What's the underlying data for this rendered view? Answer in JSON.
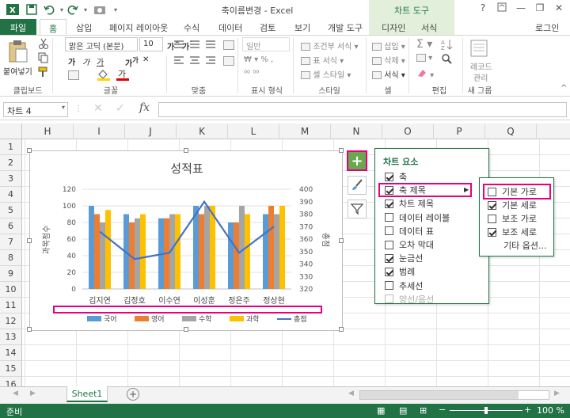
{
  "app": {
    "title": "축이름변경 - Excel",
    "context_tab": "차트 도구",
    "user": "로그인"
  },
  "tabs": [
    "파일",
    "홈",
    "삽입",
    "페이지 레이아웃",
    "수식",
    "데이터",
    "검토",
    "보기",
    "개발 도구",
    "디자인",
    "서식"
  ],
  "ribbon": {
    "paste": "붙여넣기",
    "font_name": "맑은 고딕 (본문)",
    "font_size": "10",
    "number_format": "일반",
    "cond_format": "조건부 서식",
    "table_format": "표 서식",
    "cell_style": "셀 스타일",
    "insert": "삽입",
    "delete": "삭제",
    "format": "서식",
    "record": "레코드",
    "manage": "관리",
    "groups": [
      "클립보드",
      "글꼴",
      "맞춤",
      "표시 형식",
      "스타일",
      "셀",
      "편집",
      "새 그룹"
    ]
  },
  "formula": {
    "name_box": "차트 4",
    "fx": "fx",
    "value": ""
  },
  "grid": {
    "columns": [
      "H",
      "I",
      "J",
      "K",
      "L",
      "M",
      "N",
      "O",
      "P",
      "Q"
    ],
    "rows": [
      "1",
      "2",
      "3",
      "4",
      "5",
      "6",
      "7",
      "8",
      "9",
      "10",
      "11",
      "12",
      "13",
      "14",
      "15",
      "16"
    ]
  },
  "sheet": {
    "tab": "Sheet1",
    "status": "준비",
    "zoom": "100 %"
  },
  "chart_data": {
    "type": "bar",
    "title": "성적표",
    "ylabel": "과목점수",
    "y2label": "총점",
    "categories": [
      "김지연",
      "김정호",
      "이수연",
      "이성훈",
      "정은주",
      "정상현"
    ],
    "ylim": [
      0,
      120
    ],
    "yticks": [
      "0",
      "20",
      "40",
      "60",
      "80",
      "100",
      "120"
    ],
    "y2lim": [
      320,
      400
    ],
    "y2ticks": [
      "320",
      "330",
      "340",
      "350",
      "360",
      "370",
      "380",
      "390",
      "400"
    ],
    "series": [
      {
        "name": "국어",
        "color": "#5b9bd5",
        "values": [
          100,
          90,
          85,
          100,
          80,
          90
        ]
      },
      {
        "name": "영어",
        "color": "#ed7d31",
        "values": [
          90,
          80,
          85,
          90,
          80,
          100
        ]
      },
      {
        "name": "수학",
        "color": "#a5a5a5",
        "values": [
          80,
          85,
          90,
          100,
          100,
          90
        ]
      },
      {
        "name": "과학",
        "color": "#ffc000",
        "values": [
          95,
          90,
          90,
          100,
          90,
          100
        ]
      }
    ],
    "line_series": {
      "name": "총점",
      "color": "#4472c4",
      "values": [
        366,
        344,
        349,
        390,
        349,
        370
      ]
    }
  },
  "chart_elements": {
    "title": "차트 요소",
    "items": [
      {
        "label": "축",
        "checked": true,
        "disabled": false
      },
      {
        "label": "축 제목",
        "checked": true,
        "disabled": false
      },
      {
        "label": "차트 제목",
        "checked": true,
        "disabled": false
      },
      {
        "label": "데이터 레이블",
        "checked": false,
        "disabled": false
      },
      {
        "label": "데이터 표",
        "checked": false,
        "disabled": false
      },
      {
        "label": "오차 막대",
        "checked": false,
        "disabled": false
      },
      {
        "label": "눈금선",
        "checked": true,
        "disabled": false
      },
      {
        "label": "범례",
        "checked": true,
        "disabled": false
      },
      {
        "label": "추세선",
        "checked": false,
        "disabled": false
      },
      {
        "label": "양선/음선",
        "checked": false,
        "disabled": true
      }
    ]
  },
  "axis_title_submenu": {
    "items": [
      {
        "label": "기본 가로",
        "checked": false
      },
      {
        "label": "기본 세로",
        "checked": true
      },
      {
        "label": "보조 가로",
        "checked": false
      },
      {
        "label": "보조 세로",
        "checked": true
      }
    ],
    "more": "기타 옵션..."
  }
}
